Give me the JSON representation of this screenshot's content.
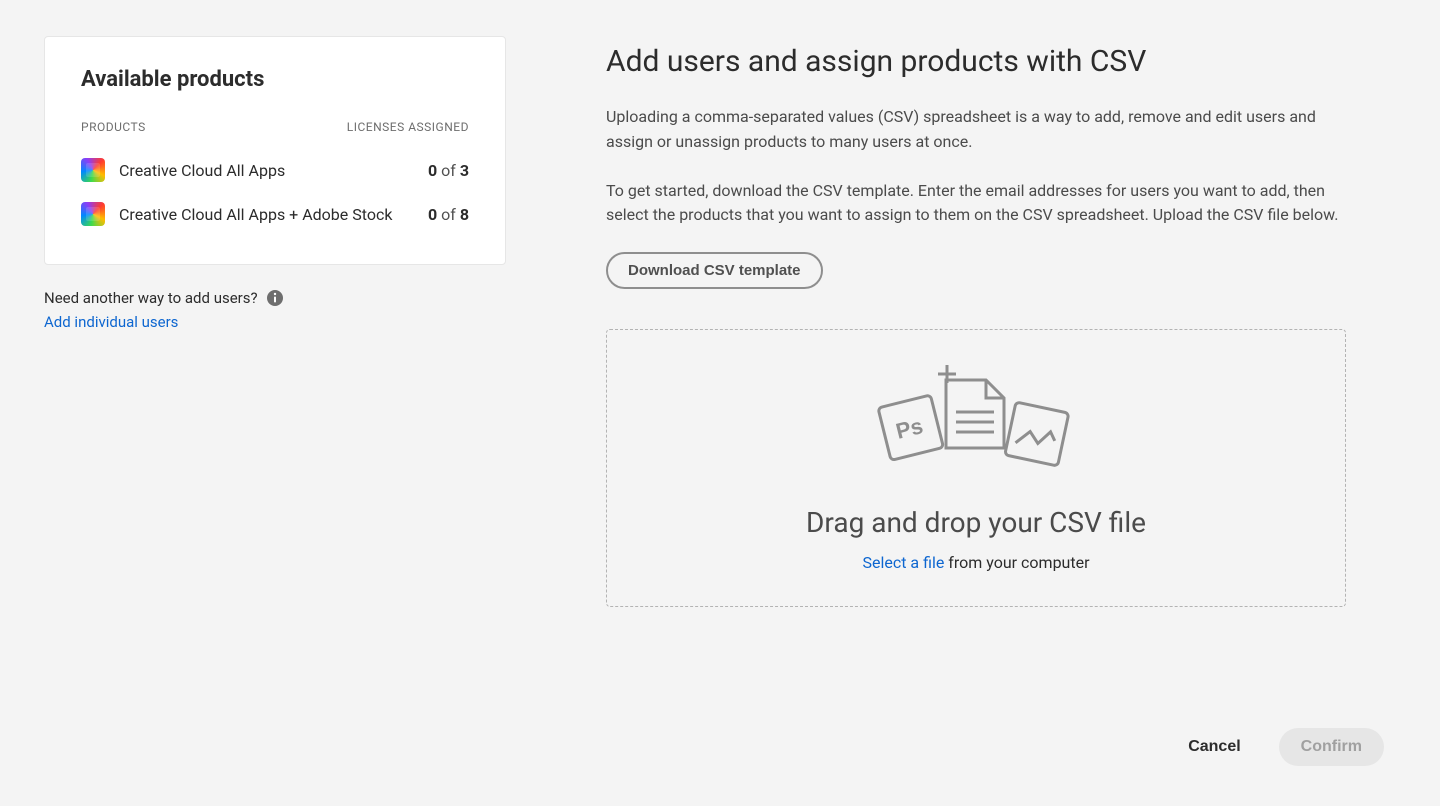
{
  "sidebar": {
    "title": "Available products",
    "header_products": "PRODUCTS",
    "header_licenses": "LICENSES ASSIGNED",
    "products": [
      {
        "name": "Creative Cloud All Apps",
        "used": "0",
        "of_label": "of",
        "total": "3"
      },
      {
        "name": "Creative Cloud All Apps + Adobe Stock",
        "used": "0",
        "of_label": "of",
        "total": "8"
      }
    ],
    "help_text": "Need another way to add users?",
    "add_individual_link": "Add individual users"
  },
  "main": {
    "title": "Add users and assign products with CSV",
    "para1": "Uploading a comma-separated values (CSV) spreadsheet is a way to add, remove and edit users and assign or unassign products to many users at once.",
    "para2": "To get started, download the CSV template. Enter the email addresses for users you want to add, then select the products that you want to assign to them on the CSV spreadsheet. Upload the CSV file below.",
    "download_button": "Download CSV template",
    "dropzone_title": "Drag and drop your CSV file",
    "select_file_link": "Select a file",
    "from_computer_text": " from your computer"
  },
  "footer": {
    "cancel": "Cancel",
    "confirm": "Confirm"
  }
}
